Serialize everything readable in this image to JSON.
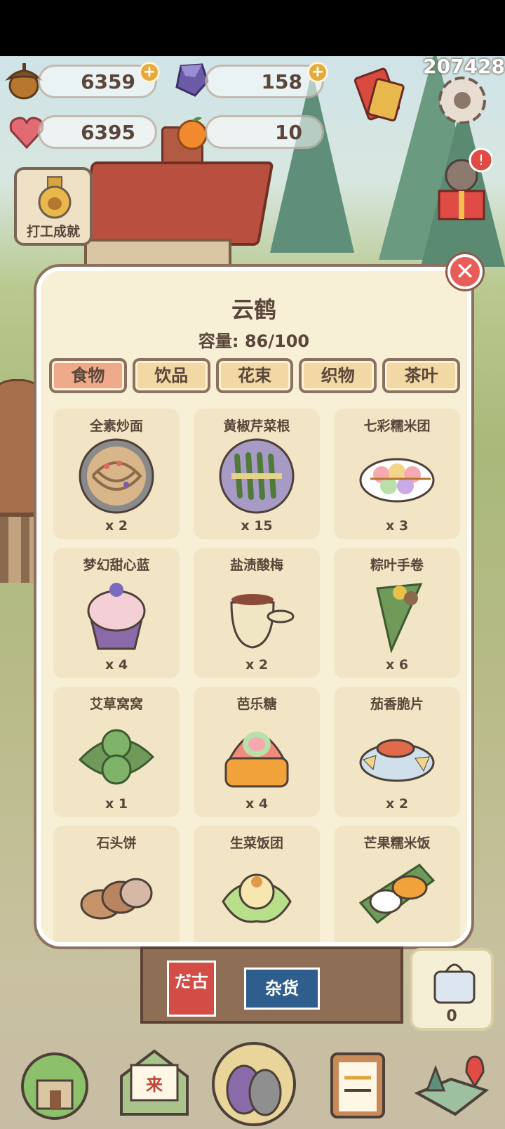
{
  "score": "207428",
  "resources": {
    "acorns": "6359",
    "gems": "158",
    "hearts": "6395",
    "oranges": "10"
  },
  "achievement": {
    "label": "打工成就"
  },
  "modal": {
    "title": "云鹤",
    "capacity": "容量: 86/100",
    "tabs": [
      {
        "label": "食物",
        "active": true
      },
      {
        "label": "饮品",
        "active": false
      },
      {
        "label": "花束",
        "active": false
      },
      {
        "label": "织物",
        "active": false
      },
      {
        "label": "茶叶",
        "active": false
      }
    ],
    "items": [
      {
        "name": "全素炒面",
        "qty": "x 2",
        "icon": "stir-fried-noodles-icon"
      },
      {
        "name": "黄椒芹菜根",
        "qty": "x 15",
        "icon": "celery-skewer-icon"
      },
      {
        "name": "七彩糯米团",
        "qty": "x 3",
        "icon": "rice-dumpling-skewer-icon"
      },
      {
        "name": "梦幻甜心蓝",
        "qty": "x 4",
        "icon": "cupcake-icon"
      },
      {
        "name": "盐渍酸梅",
        "qty": "x 2",
        "icon": "plum-jar-icon"
      },
      {
        "name": "粽叶手卷",
        "qty": "x 6",
        "icon": "leaf-wrap-icon"
      },
      {
        "name": "艾草窝窝",
        "qty": "x 1",
        "icon": "mugwort-cake-icon"
      },
      {
        "name": "芭乐糖",
        "qty": "x 4",
        "icon": "guava-candy-icon"
      },
      {
        "name": "茄香脆片",
        "qty": "x 2",
        "icon": "chips-dip-icon"
      },
      {
        "name": "石头饼",
        "qty": "",
        "icon": "stone-bread-icon"
      },
      {
        "name": "生菜饭团",
        "qty": "",
        "icon": "lettuce-riceball-icon"
      },
      {
        "name": "芒果糯米饭",
        "qty": "",
        "icon": "mango-sticky-rice-icon"
      }
    ]
  },
  "shop": {
    "sign1": "だ古",
    "sign2": "杂货"
  },
  "gift_count": "0",
  "colors": {
    "accent": "#eea98b",
    "close": "#e85d57",
    "panel": "#f8efd7"
  }
}
